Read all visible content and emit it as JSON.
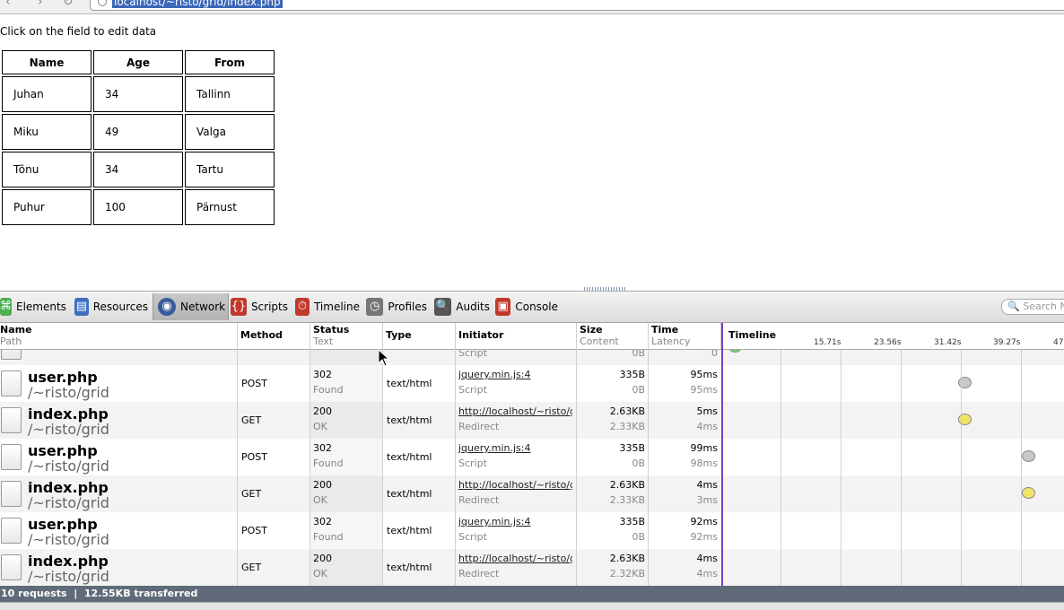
{
  "browser": {
    "url": "localhost/~risto/grid/index.php"
  },
  "page": {
    "instruction": "Click on the field to edit data",
    "table": {
      "headers": [
        "Name",
        "Age",
        "From"
      ],
      "rows": [
        [
          "Juhan",
          "34",
          "Tallinn"
        ],
        [
          "Miku",
          "49",
          "Valga"
        ],
        [
          "Tõnu",
          "34",
          "Tartu"
        ],
        [
          "Puhur",
          "100",
          "Pärnust"
        ]
      ]
    }
  },
  "devtools": {
    "tabs": [
      {
        "label": "Elements",
        "icon": "elements-icon",
        "color": "#4caf50"
      },
      {
        "label": "Resources",
        "icon": "resources-icon",
        "color": "#3f6fbf"
      },
      {
        "label": "Network",
        "icon": "network-icon",
        "color": "#3a5a9a"
      },
      {
        "label": "Scripts",
        "icon": "scripts-icon",
        "color": "#c0392b"
      },
      {
        "label": "Timeline",
        "icon": "timeline-icon",
        "color": "#c0392b"
      },
      {
        "label": "Profiles",
        "icon": "profiles-icon",
        "color": "#777777"
      },
      {
        "label": "Audits",
        "icon": "audits-icon",
        "color": "#555555"
      },
      {
        "label": "Console",
        "icon": "console-icon",
        "color": "#c0392b"
      }
    ],
    "selected_tab": "Network",
    "search_placeholder": "Search Ne",
    "columns": {
      "name": "Name",
      "path": "Path",
      "method": "Method",
      "status": "Status",
      "text": "Text",
      "type": "Type",
      "initiator": "Initiator",
      "size": "Size",
      "content": "Content",
      "time": "Time",
      "latency": "Latency",
      "timeline": "Timeline"
    },
    "timeline_ticks": [
      "15.71s",
      "23.56s",
      "31.42s",
      "39.27s",
      "47"
    ],
    "partial_row": {
      "initiator": "Script",
      "content": "0B",
      "latency": "0"
    },
    "requests": [
      {
        "name": "user.php",
        "path": "/~risto/grid",
        "method": "POST",
        "status": "302",
        "text": "Found",
        "type": "text/html",
        "initiator": "jquery.min.js:4",
        "initiator_type": "Script",
        "size": "335B",
        "content": "0B",
        "time": "95ms",
        "latency": "95ms",
        "dot": "grey",
        "dot_s": 31.9
      },
      {
        "name": "index.php",
        "path": "/~risto/grid",
        "method": "GET",
        "status": "200",
        "text": "OK",
        "type": "text/html",
        "initiator": "http://localhost/~risto/grid/i",
        "initiator_type": "Redirect",
        "size": "2.63KB",
        "content": "2.33KB",
        "time": "5ms",
        "latency": "4ms",
        "dot": "yellow",
        "dot_s": 31.9
      },
      {
        "name": "user.php",
        "path": "/~risto/grid",
        "method": "POST",
        "status": "302",
        "text": "Found",
        "type": "text/html",
        "initiator": "jquery.min.js:4",
        "initiator_type": "Script",
        "size": "335B",
        "content": "0B",
        "time": "99ms",
        "latency": "98ms",
        "dot": "grey",
        "dot_s": 40.2
      },
      {
        "name": "index.php",
        "path": "/~risto/grid",
        "method": "GET",
        "status": "200",
        "text": "OK",
        "type": "text/html",
        "initiator": "http://localhost/~risto/grid/i",
        "initiator_type": "Redirect",
        "size": "2.63KB",
        "content": "2.33KB",
        "time": "4ms",
        "latency": "3ms",
        "dot": "yellow",
        "dot_s": 40.2
      },
      {
        "name": "user.php",
        "path": "/~risto/grid",
        "method": "POST",
        "status": "302",
        "text": "Found",
        "type": "text/html",
        "initiator": "jquery.min.js:4",
        "initiator_type": "Script",
        "size": "335B",
        "content": "0B",
        "time": "92ms",
        "latency": "92ms",
        "dot": "",
        "dot_s": null
      },
      {
        "name": "index.php",
        "path": "/~risto/grid",
        "method": "GET",
        "status": "200",
        "text": "OK",
        "type": "text/html",
        "initiator": "http://localhost/~risto/grid/i",
        "initiator_type": "Redirect",
        "size": "2.63KB",
        "content": "2.32KB",
        "time": "4ms",
        "latency": "4ms",
        "dot": "",
        "dot_s": null
      }
    ],
    "status_bar": "10 requests  |  12.55KB transferred",
    "dot_colors": {
      "grey": "#c8c8c8",
      "yellow": "#f2e36b"
    }
  }
}
